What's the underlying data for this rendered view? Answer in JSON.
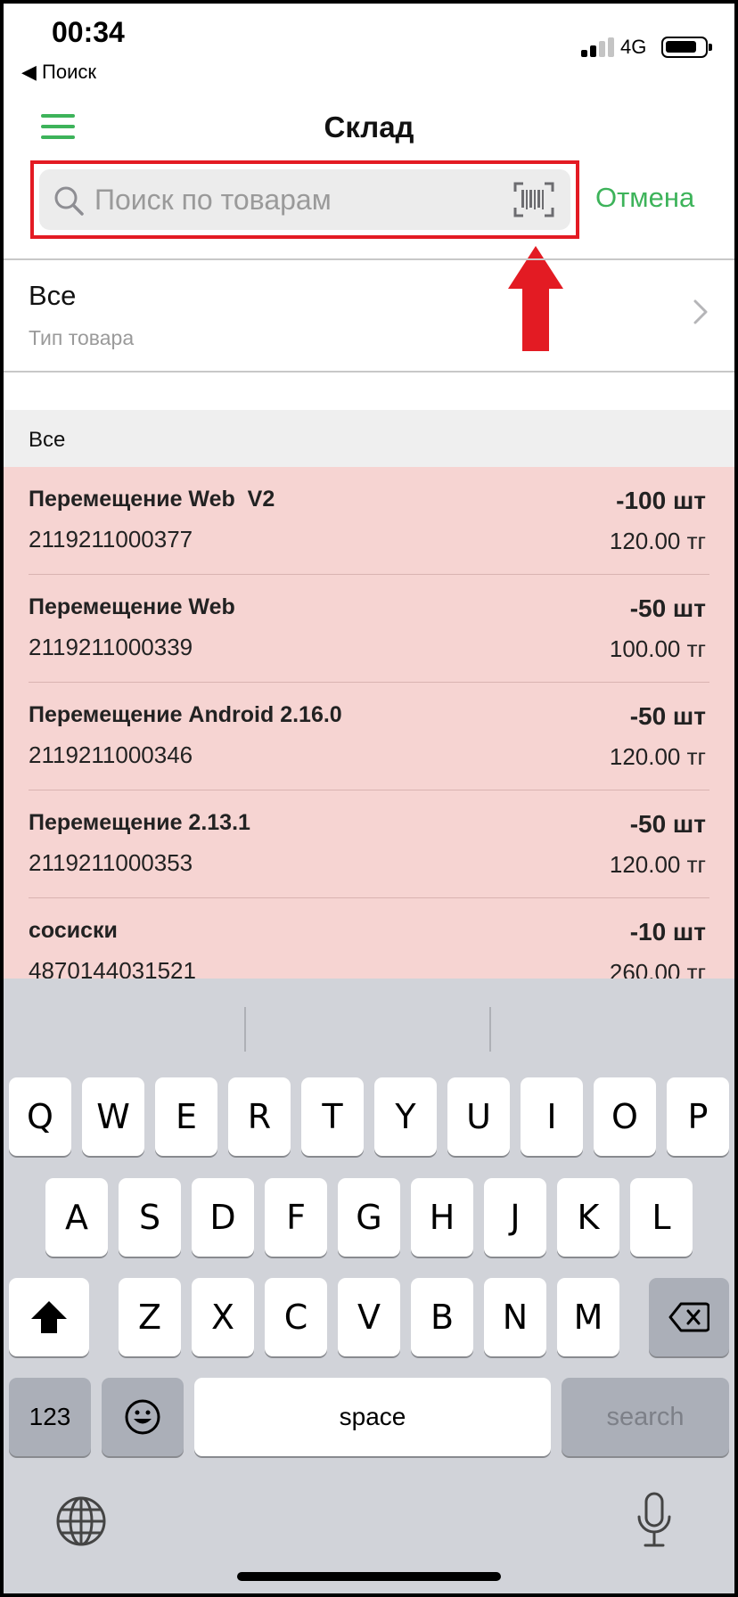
{
  "status_bar": {
    "time": "00:34",
    "back_label": "◀ Поиск",
    "network": "4G"
  },
  "nav": {
    "title": "Склад"
  },
  "search": {
    "placeholder": "Поиск по товарам",
    "value": "",
    "cancel_label": "Отмена"
  },
  "filter": {
    "value": "Все",
    "caption": "Тип товара"
  },
  "section": {
    "label": "Все"
  },
  "items": [
    {
      "name": "Перемещение Web  V2",
      "code": "2119211000377",
      "quantity": "-100 шт",
      "price": "120.00 тг"
    },
    {
      "name": "Перемещение Web",
      "code": "2119211000339",
      "quantity": "-50 шт",
      "price": "100.00 тг"
    },
    {
      "name": "Перемещение Android 2.16.0",
      "code": "2119211000346",
      "quantity": "-50 шт",
      "price": "120.00 тг"
    },
    {
      "name": "Перемещение 2.13.1",
      "code": "2119211000353",
      "quantity": "-50 шт",
      "price": "120.00 тг"
    },
    {
      "name": "сосиски",
      "code": "4870144031521",
      "quantity": "-10 шт",
      "price": "260.00 тг"
    }
  ],
  "keyboard": {
    "row1": [
      "Q",
      "W",
      "E",
      "R",
      "T",
      "Y",
      "U",
      "I",
      "O",
      "P"
    ],
    "row2": [
      "A",
      "S",
      "D",
      "F",
      "G",
      "H",
      "J",
      "K",
      "L"
    ],
    "row3": [
      "Z",
      "X",
      "C",
      "V",
      "B",
      "N",
      "M"
    ],
    "numbers_label": "123",
    "space_label": "space",
    "search_label": "search"
  },
  "colors": {
    "accent_green": "#3db35a",
    "highlight_red": "#e31b23",
    "list_background": "#f6d4d2"
  }
}
